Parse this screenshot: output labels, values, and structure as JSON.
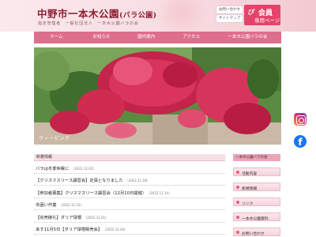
{
  "header": {
    "title_main": "中野市一本木公園",
    "title_sub": "(バラ公園)",
    "subtitle": "指定管理者　一般社団法人　一本木公園バラの会",
    "btn_contact": "お問い合わせ",
    "btn_sitemap": "サイトマップ",
    "member_logo": "ぴ",
    "member_line1": "会員",
    "member_line2": "専用ページ"
  },
  "nav": {
    "items": [
      "ホーム",
      "お知らせ",
      "園内案内",
      "アクセス",
      "一本木公園バラの会"
    ]
  },
  "hero": {
    "caption": "ウィーピング"
  },
  "social": {
    "instagram": "instagram-icon",
    "facebook": "facebook-icon",
    "fb_glyph": "f"
  },
  "news": {
    "heading": "新着情報",
    "items": [
      {
        "title": "バラは冬季休眠に",
        "date": "（2022.12.02）"
      },
      {
        "title": "【クリスマスリース講習会】定員となりました",
        "date": "（2022.11.18）"
      },
      {
        "title": "【参加者募集】クリスマスリース講習会（12月10日開催）",
        "date": "（2022.11.14）"
      },
      {
        "title": "冬囲い作業",
        "date": "（2022.11.10）"
      },
      {
        "title": "【完売御礼】ダリア球根",
        "date": "（2022.11.01）"
      },
      {
        "title": "あす11月5日【ダリア球根販売会】",
        "date": "（2022.11.04）"
      }
    ]
  },
  "sidebar": {
    "heading": "一本木公園バラの会",
    "items": [
      "活動内容",
      "新規情報",
      "リンク",
      "一本木公園資料",
      "お問い合わせ"
    ]
  },
  "colors": {
    "accent": "#de6e8b",
    "title": "#8c1f30",
    "member": "#e5436a"
  }
}
